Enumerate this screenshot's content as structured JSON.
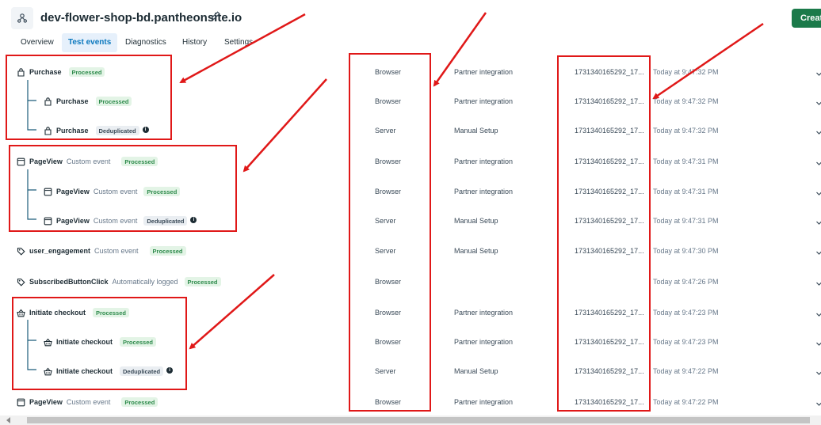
{
  "header": {
    "site_title": "dev-flower-shop-bd.pantheonsite.io",
    "create_label": "Create"
  },
  "tabs": [
    {
      "label": "Overview",
      "active": false
    },
    {
      "label": "Test events",
      "active": true
    },
    {
      "label": "Diagnostics",
      "active": false
    },
    {
      "label": "History",
      "active": false
    },
    {
      "label": "Settings",
      "active": false
    }
  ],
  "events": [
    {
      "name": "Purchase",
      "subtitle": "",
      "status": "Processed",
      "source": "Browser",
      "setup": "Partner integration",
      "event_id": "1731340165292_17...",
      "time": "Today at 9:47:32 PM",
      "icon": "shopping-bag-icon",
      "level": 0
    },
    {
      "name": "Purchase",
      "subtitle": "",
      "status": "Processed",
      "source": "Browser",
      "setup": "Partner integration",
      "event_id": "1731340165292_17...",
      "time": "Today at 9:47:32 PM",
      "icon": "shopping-bag-icon",
      "level": 1
    },
    {
      "name": "Purchase",
      "subtitle": "",
      "status": "Deduplicated",
      "source": "Server",
      "setup": "Manual Setup",
      "event_id": "1731340165292_17...",
      "time": "Today at 9:47:32 PM",
      "icon": "shopping-bag-icon",
      "level": 1
    },
    {
      "name": "PageView",
      "subtitle": "Custom event",
      "status": "Processed",
      "source": "Browser",
      "setup": "Partner integration",
      "event_id": "1731340165292_17...",
      "time": "Today at 9:47:31 PM",
      "icon": "page-icon",
      "level": 0
    },
    {
      "name": "PageView",
      "subtitle": "Custom event",
      "status": "Processed",
      "source": "Browser",
      "setup": "Partner integration",
      "event_id": "1731340165292_17...",
      "time": "Today at 9:47:31 PM",
      "icon": "page-icon",
      "level": 1
    },
    {
      "name": "PageView",
      "subtitle": "Custom event",
      "status": "Deduplicated",
      "source": "Server",
      "setup": "Manual Setup",
      "event_id": "1731340165292_17...",
      "time": "Today at 9:47:31 PM",
      "icon": "page-icon",
      "level": 1
    },
    {
      "name": "user_engagement",
      "subtitle": "Custom event",
      "status": "Processed",
      "source": "Server",
      "setup": "Manual Setup",
      "event_id": "1731340165292_17...",
      "time": "Today at 9:47:30 PM",
      "icon": "tag-icon",
      "level": 0
    },
    {
      "name": "SubscribedButtonClick",
      "subtitle": "Automatically logged",
      "status": "Processed",
      "source": "Browser",
      "setup": "",
      "event_id": "",
      "time": "Today at 9:47:26 PM",
      "icon": "tag-icon",
      "level": 0
    },
    {
      "name": "Initiate checkout",
      "subtitle": "",
      "status": "Processed",
      "source": "Browser",
      "setup": "Partner integration",
      "event_id": "1731340165292_17...",
      "time": "Today at 9:47:23 PM",
      "icon": "basket-icon",
      "level": 0
    },
    {
      "name": "Initiate checkout",
      "subtitle": "",
      "status": "Processed",
      "source": "Browser",
      "setup": "Partner integration",
      "event_id": "1731340165292_17...",
      "time": "Today at 9:47:23 PM",
      "icon": "basket-icon",
      "level": 1
    },
    {
      "name": "Initiate checkout",
      "subtitle": "",
      "status": "Deduplicated",
      "source": "Server",
      "setup": "Manual Setup",
      "event_id": "1731340165292_17...",
      "time": "Today at 9:47:22 PM",
      "icon": "basket-icon",
      "level": 1
    },
    {
      "name": "PageView",
      "subtitle": "Custom event",
      "status": "Processed",
      "source": "Browser",
      "setup": "Partner integration",
      "event_id": "1731340165292_17...",
      "time": "Today at 9:47:22 PM",
      "icon": "page-icon",
      "level": 0
    }
  ],
  "annotation_color": "#e01818"
}
